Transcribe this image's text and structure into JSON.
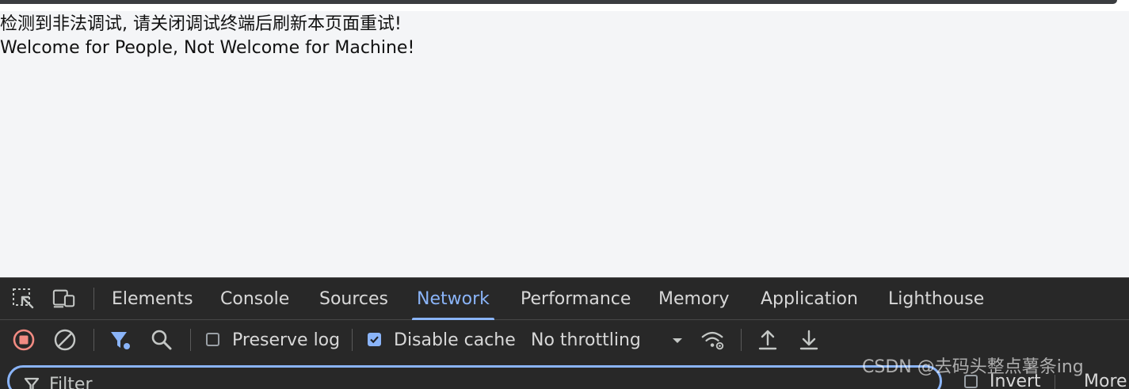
{
  "page": {
    "line1": "检测到非法调试, 请关闭调试终端后刷新本页面重试!",
    "line2": "Welcome for People, Not Welcome for Machine!"
  },
  "devtools": {
    "tabs": [
      {
        "label": "Elements"
      },
      {
        "label": "Console"
      },
      {
        "label": "Sources"
      },
      {
        "label": "Network",
        "active": true
      },
      {
        "label": "Performance"
      },
      {
        "label": "Memory"
      },
      {
        "label": "Application"
      },
      {
        "label": "Lighthouse"
      }
    ],
    "toolbar": {
      "preserve_log_label": "Preserve log",
      "preserve_log_checked": false,
      "disable_cache_label": "Disable cache",
      "disable_cache_checked": true,
      "throttling_value": "No throttling"
    },
    "filter": {
      "placeholder": "Filter",
      "invert_label": "Invert",
      "more_label": "More"
    }
  },
  "watermark": "CSDN @去码头整点薯条ing",
  "colors": {
    "page_background": "#f4f5f7",
    "devtools_background": "#282828",
    "accent": "#8ab4f8",
    "record_red": "#f28b82"
  }
}
